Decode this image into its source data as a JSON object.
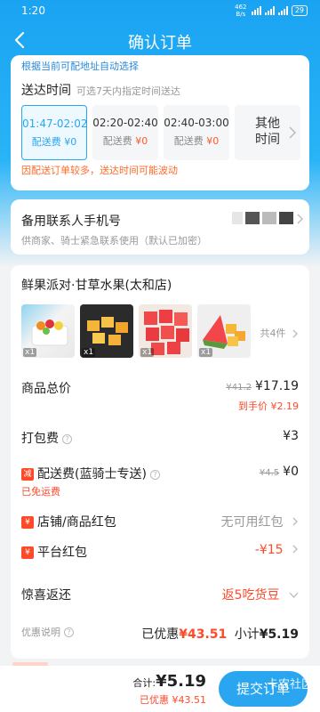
{
  "status": {
    "time": "1:20",
    "net": "462 B/s",
    "battery": "29"
  },
  "nav": {
    "title": "确认订单"
  },
  "delivery": {
    "hint_top": "根据当前可配地址自动选择",
    "title": "送达时间",
    "subtitle": "可选7天内指定时间送达",
    "slots": [
      {
        "time": "01:47-02:02",
        "fee_label": "配送费",
        "fee": "¥0"
      },
      {
        "time": "02:20-02:40",
        "fee_label": "配送费",
        "fee": "¥0"
      },
      {
        "time": "02:40-03:00",
        "fee_label": "配送费",
        "fee": "¥0"
      }
    ],
    "other_line1": "其他",
    "other_line2": "时间",
    "hint_bottom": "因配送订单较多，送达时间可能波动"
  },
  "backup": {
    "title": "备用联系人手机号",
    "subtitle": "供商家、骑士紧急联系使用（默认已加密）"
  },
  "order": {
    "shop": "鲜果派对·甘草水果(太和店)",
    "item_qty": [
      "x1",
      "x1",
      "x1",
      "x1"
    ],
    "total_items": "共4件",
    "goods_total_label": "商品总价",
    "goods_total_orig": "¥41.2",
    "goods_total": "¥17.19",
    "goods_unit_price": "到手价 ¥2.19",
    "packing_label": "打包费",
    "packing_value": "¥3",
    "delivery_tag": "减",
    "delivery_label": "配送费(蓝骑士专送)",
    "delivery_orig": "¥4.5",
    "delivery_value": "¥0",
    "delivery_free": "已免运费",
    "shop_redpack_tag": "¥",
    "shop_redpack_label": "店铺/商品红包",
    "shop_redpack_value": "无可用红包",
    "platform_redpack_tag": "¥",
    "platform_redpack_label": "平台红包",
    "platform_redpack_value": "-¥15",
    "surprise_label": "惊喜返还",
    "surprise_value": "返5吃货豆",
    "discount_note_label": "优惠说明",
    "discount_prefix": "已优惠",
    "discount_value": "¥43.51",
    "subtotal_prefix": "小计",
    "subtotal_value": "¥5.19"
  },
  "footer": {
    "total_prefix": "合计:",
    "total_value": "¥5.19",
    "discount_text": "已优惠 ¥43.51",
    "submit_label": "提交订单",
    "watermark": "卡农社区"
  },
  "colors": {
    "brand": "#1aa3f2",
    "accent_red": "#ff4a2a"
  }
}
